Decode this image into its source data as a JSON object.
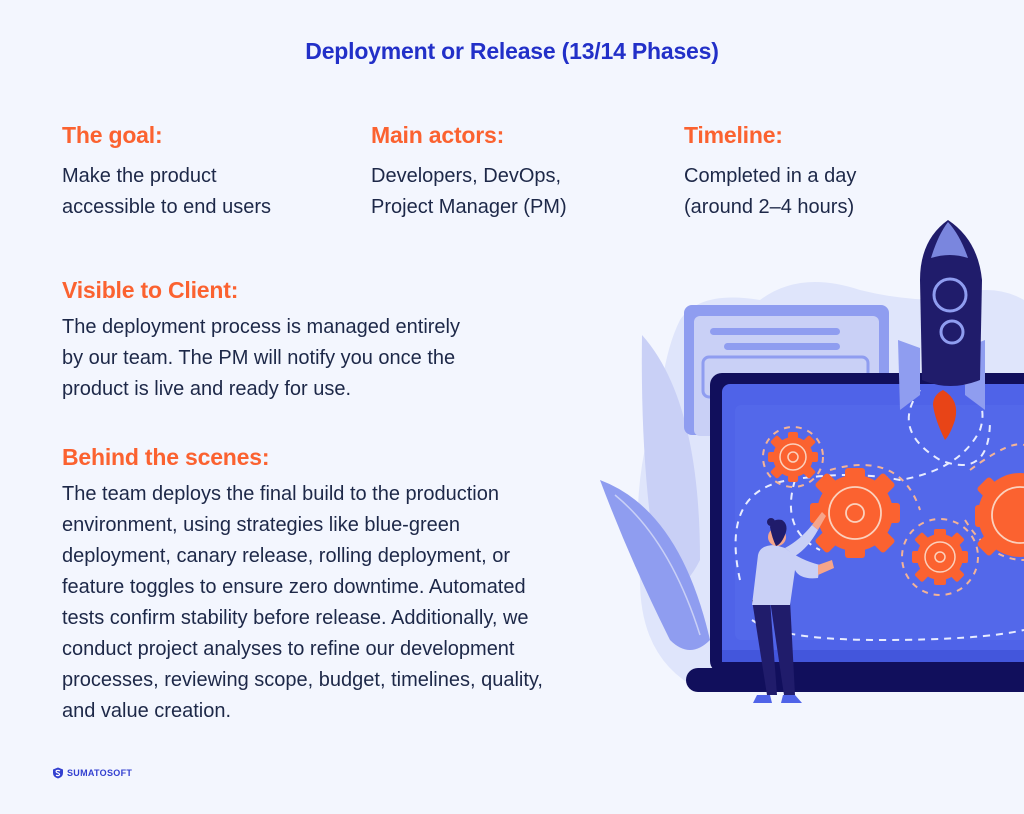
{
  "title": "Deployment or Release (13/14 Phases)",
  "columns": [
    {
      "heading": "The goal:",
      "lines": [
        "Make the product",
        "accessible to end users"
      ]
    },
    {
      "heading": "Main actors:",
      "lines": [
        "Developers, DevOps,",
        "Project Manager (PM)"
      ]
    },
    {
      "heading": "Timeline:",
      "lines": [
        "Completed in a day",
        "(around 2–4 hours)"
      ]
    }
  ],
  "visible_to_client": {
    "heading": "Visible to Client:",
    "lines": [
      "The deployment process is managed entirely",
      "by our team. The PM will notify you once the",
      "product is live and ready for use."
    ]
  },
  "behind_the_scenes": {
    "heading": "Behind the scenes:",
    "lines": [
      "The team deploys the final build to the production",
      "environment, using strategies like blue-green",
      "deployment, canary release, rolling deployment, or",
      "feature toggles to ensure zero downtime. Automated",
      "tests confirm stability before release. Additionally, we",
      "conduct project analyses to refine our development",
      "processes, reviewing scope, budget, timelines, quality,",
      "and value creation."
    ]
  },
  "brand": {
    "name": "SUMATOSOFT",
    "icon": "shield-s-logo-icon"
  },
  "illustration": {
    "description": "laptop with gears and launching rocket, person holding a gear",
    "icons": [
      "rocket-icon",
      "gear-icon",
      "laptop-icon",
      "person-icon",
      "document-icon",
      "leaf-icon"
    ]
  },
  "colors": {
    "background": "#f3f6fe",
    "title": "#2230c8",
    "heading": "#fb6230",
    "text": "#1d2848",
    "screen": "#4f63e8",
    "laptop_frame": "#110f5c",
    "gear": "#fb6230",
    "rocket_body": "#201c6b",
    "flame": "#e84417"
  }
}
